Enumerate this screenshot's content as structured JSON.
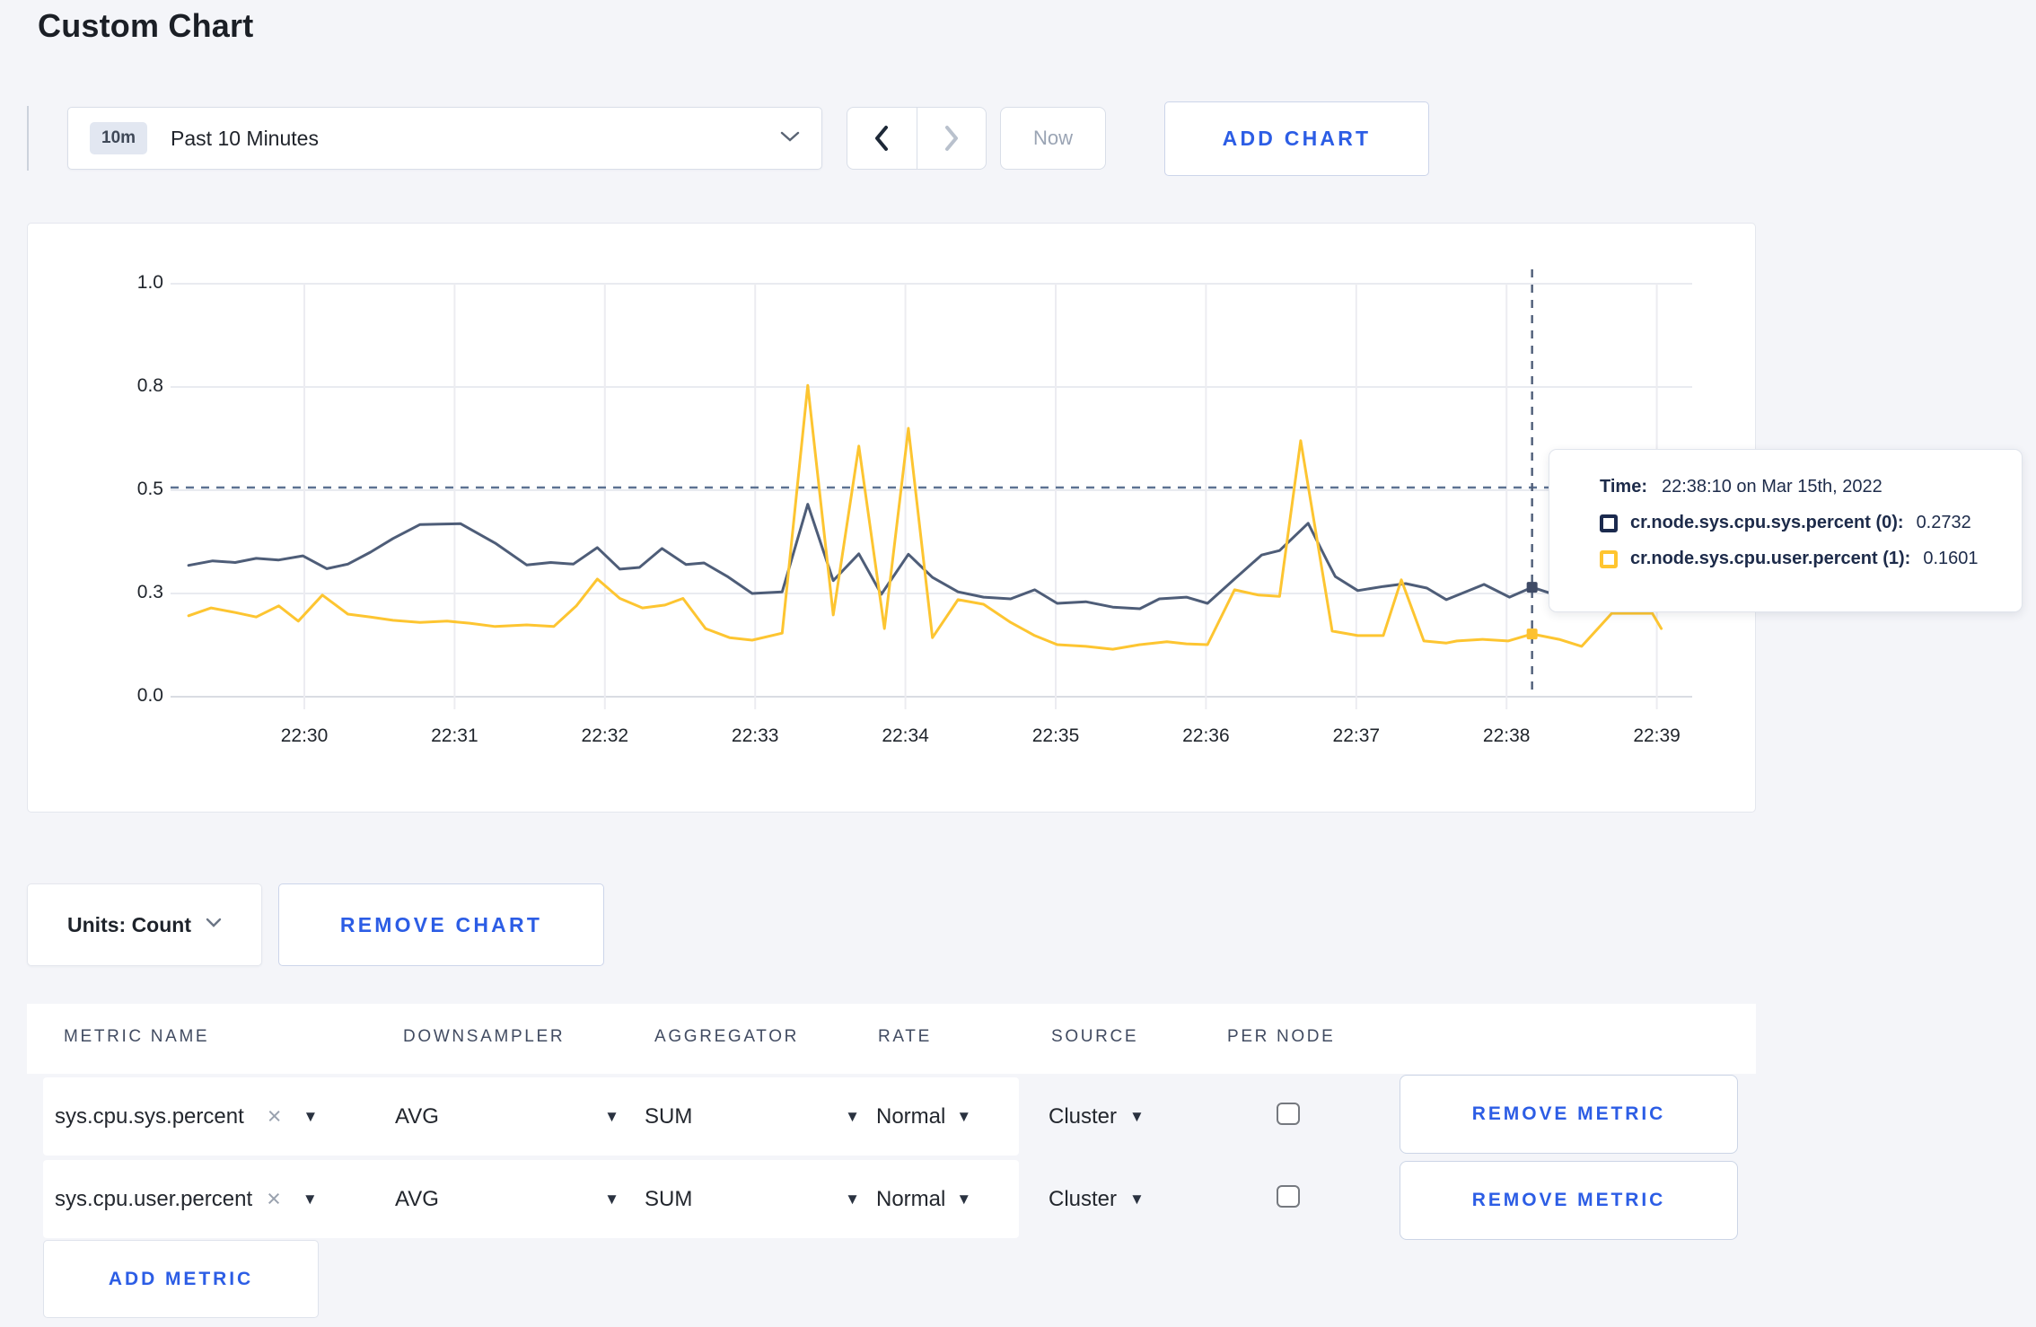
{
  "page": {
    "title": "Custom Chart",
    "background": "#f4f5f9",
    "accent_blue": "#2c5de5"
  },
  "toolbar": {
    "time_window_badge": "10m",
    "time_window_label": "Past 10 Minutes",
    "now_label": "Now",
    "add_chart_label": "ADD CHART",
    "prev_enabled": true,
    "next_enabled": false
  },
  "chart_data": {
    "type": "line",
    "title": "",
    "xlabel": "",
    "ylabel": "",
    "grid": true,
    "legend_position": "none",
    "x_axis": {
      "tick_labels": [
        "22:30",
        "22:31",
        "22:32",
        "22:33",
        "22:34",
        "22:35",
        "22:36",
        "22:37",
        "22:38",
        "22:39"
      ],
      "tick_minutes": [
        0,
        1,
        2,
        3,
        4,
        5,
        6,
        7,
        8,
        9
      ]
    },
    "y_axis": {
      "range": [
        0,
        1
      ],
      "ticks": [
        {
          "value": 0,
          "label": "0.0"
        },
        {
          "value": 0.25,
          "label": "0.3"
        },
        {
          "value": 0.5,
          "label": "0.5"
        },
        {
          "value": 0.75,
          "label": "0.8"
        },
        {
          "value": 1,
          "label": "1.0"
        }
      ]
    },
    "series": [
      {
        "name": "cr.node.sys.cpu.sys.percent",
        "color": "#4e5d78",
        "points": [
          [
            -0.77,
            0.318
          ],
          [
            -0.61,
            0.329
          ],
          [
            -0.46,
            0.325
          ],
          [
            -0.32,
            0.335
          ],
          [
            -0.17,
            0.331
          ],
          [
            -0.01,
            0.341
          ],
          [
            0.15,
            0.31
          ],
          [
            0.29,
            0.321
          ],
          [
            0.44,
            0.35
          ],
          [
            0.59,
            0.383
          ],
          [
            0.77,
            0.417
          ],
          [
            0.9,
            0.418
          ],
          [
            1.04,
            0.419
          ],
          [
            1.27,
            0.372
          ],
          [
            1.48,
            0.319
          ],
          [
            1.64,
            0.325
          ],
          [
            1.79,
            0.321
          ],
          [
            1.95,
            0.361
          ],
          [
            2.1,
            0.309
          ],
          [
            2.23,
            0.313
          ],
          [
            2.38,
            0.359
          ],
          [
            2.54,
            0.32
          ],
          [
            2.66,
            0.324
          ],
          [
            2.82,
            0.29
          ],
          [
            2.98,
            0.25
          ],
          [
            3.18,
            0.254
          ],
          [
            3.35,
            0.466
          ],
          [
            3.52,
            0.281
          ],
          [
            3.69,
            0.346
          ],
          [
            3.84,
            0.248
          ],
          [
            4.02,
            0.345
          ],
          [
            4.18,
            0.289
          ],
          [
            4.35,
            0.254
          ],
          [
            4.52,
            0.241
          ],
          [
            4.7,
            0.237
          ],
          [
            4.86,
            0.259
          ],
          [
            5.01,
            0.226
          ],
          [
            5.2,
            0.23
          ],
          [
            5.38,
            0.217
          ],
          [
            5.56,
            0.213
          ],
          [
            5.69,
            0.237
          ],
          [
            5.87,
            0.241
          ],
          [
            6.01,
            0.226
          ],
          [
            6.19,
            0.285
          ],
          [
            6.37,
            0.343
          ],
          [
            6.49,
            0.354
          ],
          [
            6.68,
            0.42
          ],
          [
            6.81,
            0.326
          ],
          [
            6.86,
            0.291
          ],
          [
            7.01,
            0.257
          ],
          [
            7.18,
            0.267
          ],
          [
            7.33,
            0.274
          ],
          [
            7.47,
            0.263
          ],
          [
            7.6,
            0.235
          ],
          [
            7.85,
            0.272
          ],
          [
            8.02,
            0.241
          ],
          [
            8.17,
            0.265
          ],
          [
            8.33,
            0.246
          ],
          [
            8.6,
            0.29
          ],
          [
            9.03,
            0.29
          ]
        ]
      },
      {
        "name": "cr.node.sys.cpu.user.percent",
        "color": "#fdc531",
        "points": [
          [
            -0.77,
            0.196
          ],
          [
            -0.62,
            0.215
          ],
          [
            -0.46,
            0.204
          ],
          [
            -0.32,
            0.193
          ],
          [
            -0.17,
            0.22
          ],
          [
            -0.04,
            0.183
          ],
          [
            0.12,
            0.246
          ],
          [
            0.29,
            0.2
          ],
          [
            0.44,
            0.193
          ],
          [
            0.59,
            0.185
          ],
          [
            0.77,
            0.18
          ],
          [
            0.95,
            0.183
          ],
          [
            1.1,
            0.178
          ],
          [
            1.27,
            0.17
          ],
          [
            1.48,
            0.174
          ],
          [
            1.66,
            0.17
          ],
          [
            1.81,
            0.22
          ],
          [
            1.95,
            0.285
          ],
          [
            2.1,
            0.238
          ],
          [
            2.25,
            0.215
          ],
          [
            2.4,
            0.222
          ],
          [
            2.52,
            0.238
          ],
          [
            2.67,
            0.165
          ],
          [
            2.83,
            0.143
          ],
          [
            2.98,
            0.137
          ],
          [
            3.18,
            0.154
          ],
          [
            3.35,
            0.754
          ],
          [
            3.52,
            0.198
          ],
          [
            3.69,
            0.607
          ],
          [
            3.86,
            0.165
          ],
          [
            4.02,
            0.65
          ],
          [
            4.18,
            0.143
          ],
          [
            4.35,
            0.235
          ],
          [
            4.52,
            0.224
          ],
          [
            4.7,
            0.18
          ],
          [
            4.86,
            0.148
          ],
          [
            5.01,
            0.126
          ],
          [
            5.2,
            0.122
          ],
          [
            5.38,
            0.115
          ],
          [
            5.56,
            0.126
          ],
          [
            5.74,
            0.133
          ],
          [
            5.87,
            0.128
          ],
          [
            6.01,
            0.126
          ],
          [
            6.19,
            0.259
          ],
          [
            6.35,
            0.246
          ],
          [
            6.49,
            0.243
          ],
          [
            6.63,
            0.62
          ],
          [
            6.84,
            0.159
          ],
          [
            7.01,
            0.148
          ],
          [
            7.18,
            0.148
          ],
          [
            7.3,
            0.283
          ],
          [
            7.45,
            0.135
          ],
          [
            7.6,
            0.13
          ],
          [
            7.67,
            0.135
          ],
          [
            7.84,
            0.139
          ],
          [
            8.01,
            0.135
          ],
          [
            8.17,
            0.152
          ],
          [
            8.35,
            0.139
          ],
          [
            8.5,
            0.122
          ],
          [
            8.7,
            0.202
          ],
          [
            8.97,
            0.202
          ],
          [
            9.03,
            0.165
          ]
        ]
      }
    ],
    "crosshair": {
      "time_minutes": 8.17,
      "hline_value": 0.5065,
      "dots": [
        {
          "value": 0.265,
          "color": "#3f4b66"
        },
        {
          "value": 0.152,
          "color": "#fdc12f"
        }
      ]
    }
  },
  "tooltip": {
    "time_label": "Time:",
    "time_value": "22:38:10 on Mar 15th, 2022",
    "rows": [
      {
        "label": "cr.node.sys.cpu.sys.percent (0):",
        "value": "0.2732",
        "color": "#1b2a4e"
      },
      {
        "label": "cr.node.sys.cpu.user.percent (1):",
        "value": "0.1601",
        "color": "#ffc52f"
      }
    ]
  },
  "chart_footer": {
    "units_label": "Units: Count",
    "remove_chart_label": "REMOVE CHART"
  },
  "metrics_table": {
    "headers": [
      "METRIC NAME",
      "DOWNSAMPLER",
      "AGGREGATOR",
      "RATE",
      "SOURCE",
      "PER NODE"
    ],
    "rows": [
      {
        "metric": "sys.cpu.sys.percent",
        "close": "×",
        "downsampler": "AVG",
        "aggregator": "SUM",
        "rate": "Normal",
        "source": "Cluster",
        "per_node_checked": false,
        "remove_label": "REMOVE METRIC"
      },
      {
        "metric": "sys.cpu.user.percent",
        "close": "×",
        "downsampler": "AVG",
        "aggregator": "SUM",
        "rate": "Normal",
        "source": "Cluster",
        "per_node_checked": false,
        "remove_label": "REMOVE METRIC"
      }
    ],
    "add_metric_label": "ADD METRIC"
  }
}
